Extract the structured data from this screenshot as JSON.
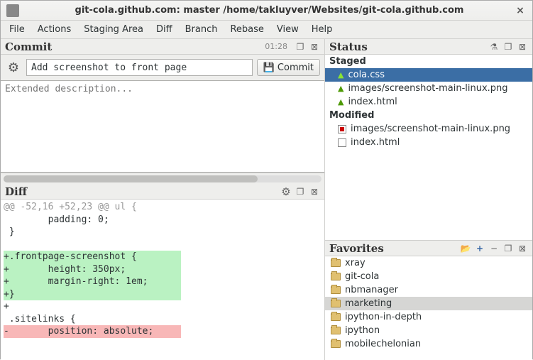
{
  "window": {
    "title": "git-cola.github.com: master /home/takluyver/Websites/git-cola.github.com"
  },
  "menubar": [
    "File",
    "Actions",
    "Staging Area",
    "Diff",
    "Branch",
    "Rebase",
    "View",
    "Help"
  ],
  "commit": {
    "panel_title": "Commit",
    "counter": "01:28",
    "summary": "Add screenshot to front page",
    "button_label": "Commit",
    "desc_placeholder": "Extended description..."
  },
  "diff": {
    "panel_title": "Diff",
    "lines": [
      {
        "cls": "diff-hunk",
        "text": "@@ -52,16 +52,23 @@ ul {"
      },
      {
        "cls": "diff-ctx",
        "text": "        padding: 0;"
      },
      {
        "cls": "diff-ctx",
        "text": " }"
      },
      {
        "cls": "diff-ctx",
        "text": ""
      },
      {
        "cls": "diff-add-bg",
        "text": "+.frontpage-screenshot {"
      },
      {
        "cls": "diff-add-bg",
        "text": "+       height: 350px;"
      },
      {
        "cls": "diff-add-bg",
        "text": "+       margin-right: 1em;"
      },
      {
        "cls": "diff-add-bg",
        "text": "+}"
      },
      {
        "cls": "diff-add",
        "text": "+"
      },
      {
        "cls": "diff-ctx",
        "text": " .sitelinks {"
      },
      {
        "cls": "diff-del-bg",
        "text": "-       position: absolute;"
      }
    ]
  },
  "status": {
    "panel_title": "Status",
    "sections": [
      {
        "name": "Staged",
        "items": [
          {
            "icon": "tri",
            "label": "cola.css",
            "selected": true
          },
          {
            "icon": "tri",
            "label": "images/screenshot-main-linux.png"
          },
          {
            "icon": "tri",
            "label": "index.html"
          }
        ]
      },
      {
        "name": "Modified",
        "items": [
          {
            "icon": "file-red",
            "label": "images/screenshot-main-linux.png"
          },
          {
            "icon": "file",
            "label": "index.html"
          }
        ]
      }
    ]
  },
  "favorites": {
    "panel_title": "Favorites",
    "items": [
      {
        "label": "xray"
      },
      {
        "label": "git-cola"
      },
      {
        "label": "nbmanager"
      },
      {
        "label": "marketing",
        "selected": true
      },
      {
        "label": "ipython-in-depth"
      },
      {
        "label": "ipython"
      },
      {
        "label": "mobilechelonian"
      }
    ]
  }
}
